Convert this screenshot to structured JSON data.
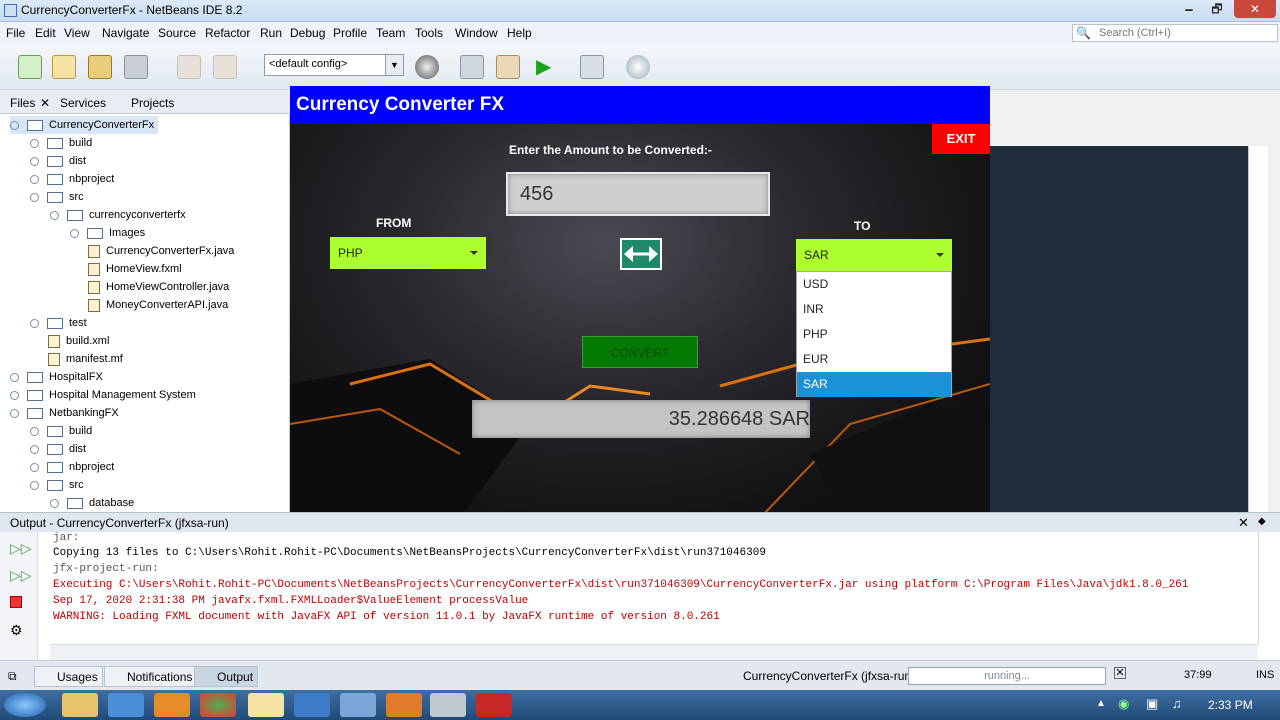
{
  "window": {
    "title": "CurrencyConverterFx - NetBeans IDE 8.2",
    "min": "🗕",
    "max": "🗗",
    "close": "✕"
  },
  "menu": [
    "File",
    "Edit",
    "View",
    "Navigate",
    "Source",
    "Refactor",
    "Run",
    "Debug",
    "Profile",
    "Team",
    "Tools",
    "Window",
    "Help"
  ],
  "search": {
    "placeholder": "Search (Ctrl+I)"
  },
  "toolbar": {
    "config": "<default config>"
  },
  "left_panel": {
    "tabs": [
      "Files",
      "Services",
      "Projects"
    ],
    "tree": [
      "CurrencyConverterFx",
      "build",
      "dist",
      "nbproject",
      "src",
      "currencyconverterfx",
      "Images",
      "CurrencyConverterFx.java",
      "HomeView.fxml",
      "HomeViewController.java",
      "MoneyConverterAPI.java",
      "test",
      "build.xml",
      "manifest.mf",
      "HospitalFX",
      "Hospital Management System",
      "NetbankingFX",
      "build",
      "dist",
      "nbproject",
      "src",
      "database"
    ]
  },
  "fx_app": {
    "title": "Currency Converter FX",
    "exit_label": "EXIT",
    "amount_label": "Enter the Amount to be Converted:-",
    "amount_value": "456",
    "from_label": "FROM",
    "to_label": "TO",
    "from_value": "PHP",
    "to_value": "SAR",
    "convert_label": "CONVERT",
    "result": "35.286648 SAR",
    "to_options": [
      "USD",
      "INR",
      "PHP",
      "EUR",
      "SAR"
    ],
    "to_selected": "SAR"
  },
  "output": {
    "title": "Output - CurrencyConverterFx (jfxsa-run)",
    "lines": [
      {
        "text": "jar:",
        "color": "#555555"
      },
      {
        "text": "Copying 13 files to C:\\Users\\Rohit.Rohit-PC\\Documents\\NetBeansProjects\\CurrencyConverterFx\\dist\\run371046309",
        "color": "#000000"
      },
      {
        "text": "jfx-project-run:",
        "color": "#555555"
      },
      {
        "text": "Executing C:\\Users\\Rohit.Rohit-PC\\Documents\\NetBeansProjects\\CurrencyConverterFx\\dist\\run371046309\\CurrencyConverterFx.jar using platform C:\\Program Files\\Java\\jdk1.8.0_261",
        "color": "#c00000"
      },
      {
        "text": "Sep 17, 2020 2:31:38 PM javafx.fxml.FXMLLoader$ValueElement processValue",
        "color": "#c00000"
      },
      {
        "text": "WARNING: Loading FXML document with JavaFX API of version 11.0.1 by JavaFX runtime of version 8.0.261",
        "color": "#c00000"
      }
    ]
  },
  "statusbar": {
    "tabs": [
      "Usages",
      "Notifications",
      "Output"
    ],
    "run_status": "CurrencyConverterFx (jfxsa-run)",
    "progress_text": "running...",
    "cursor": "37:99",
    "mode": "INS"
  },
  "taskbar": {
    "clock": "2:33 PM"
  }
}
